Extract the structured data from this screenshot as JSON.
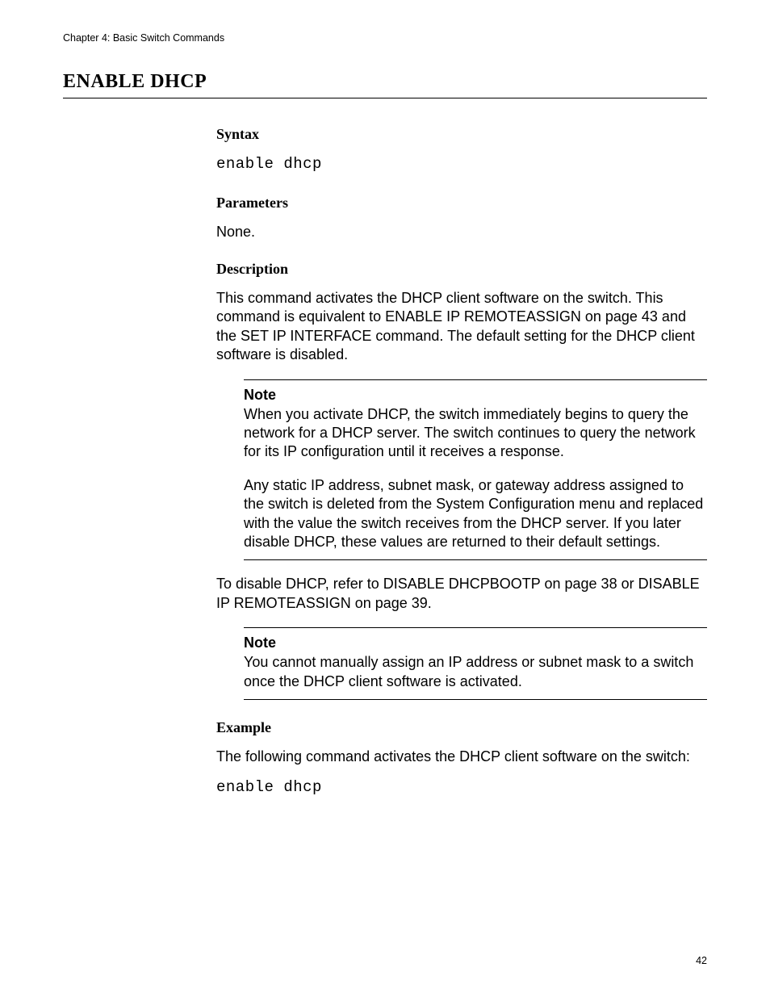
{
  "header": {
    "running": "Chapter 4: Basic Switch Commands"
  },
  "title": "ENABLE DHCP",
  "sections": {
    "syntax": {
      "heading": "Syntax",
      "code": "enable dhcp"
    },
    "parameters": {
      "heading": "Parameters",
      "text": "None."
    },
    "description": {
      "heading": "Description",
      "intro": "This command activates the DHCP client software on the switch. This command is equivalent to ENABLE IP REMOTEASSIGN on page 43 and the SET IP INTERFACE command. The default setting for the DHCP client software is disabled.",
      "note1": {
        "label": "Note",
        "p1": "When you activate DHCP, the switch immediately begins to query the network for a DHCP server. The switch continues to query the network for its IP configuration until it receives a response.",
        "p2": "Any static IP address, subnet mask, or gateway address assigned to the switch is deleted from the System Configuration menu and replaced with the value the switch receives from the DHCP server. If you later disable DHCP, these values are returned to their default settings."
      },
      "after_note1": "To disable DHCP, refer to DISABLE DHCPBOOTP on page 38 or DISABLE IP REMOTEASSIGN on page 39.",
      "note2": {
        "label": "Note",
        "p1": "You cannot manually assign an IP address or subnet mask to a switch once the DHCP client software is activated."
      }
    },
    "example": {
      "heading": "Example",
      "text": "The following command activates the DHCP client software on the switch:",
      "code": "enable dhcp"
    }
  },
  "pageNumber": "42"
}
